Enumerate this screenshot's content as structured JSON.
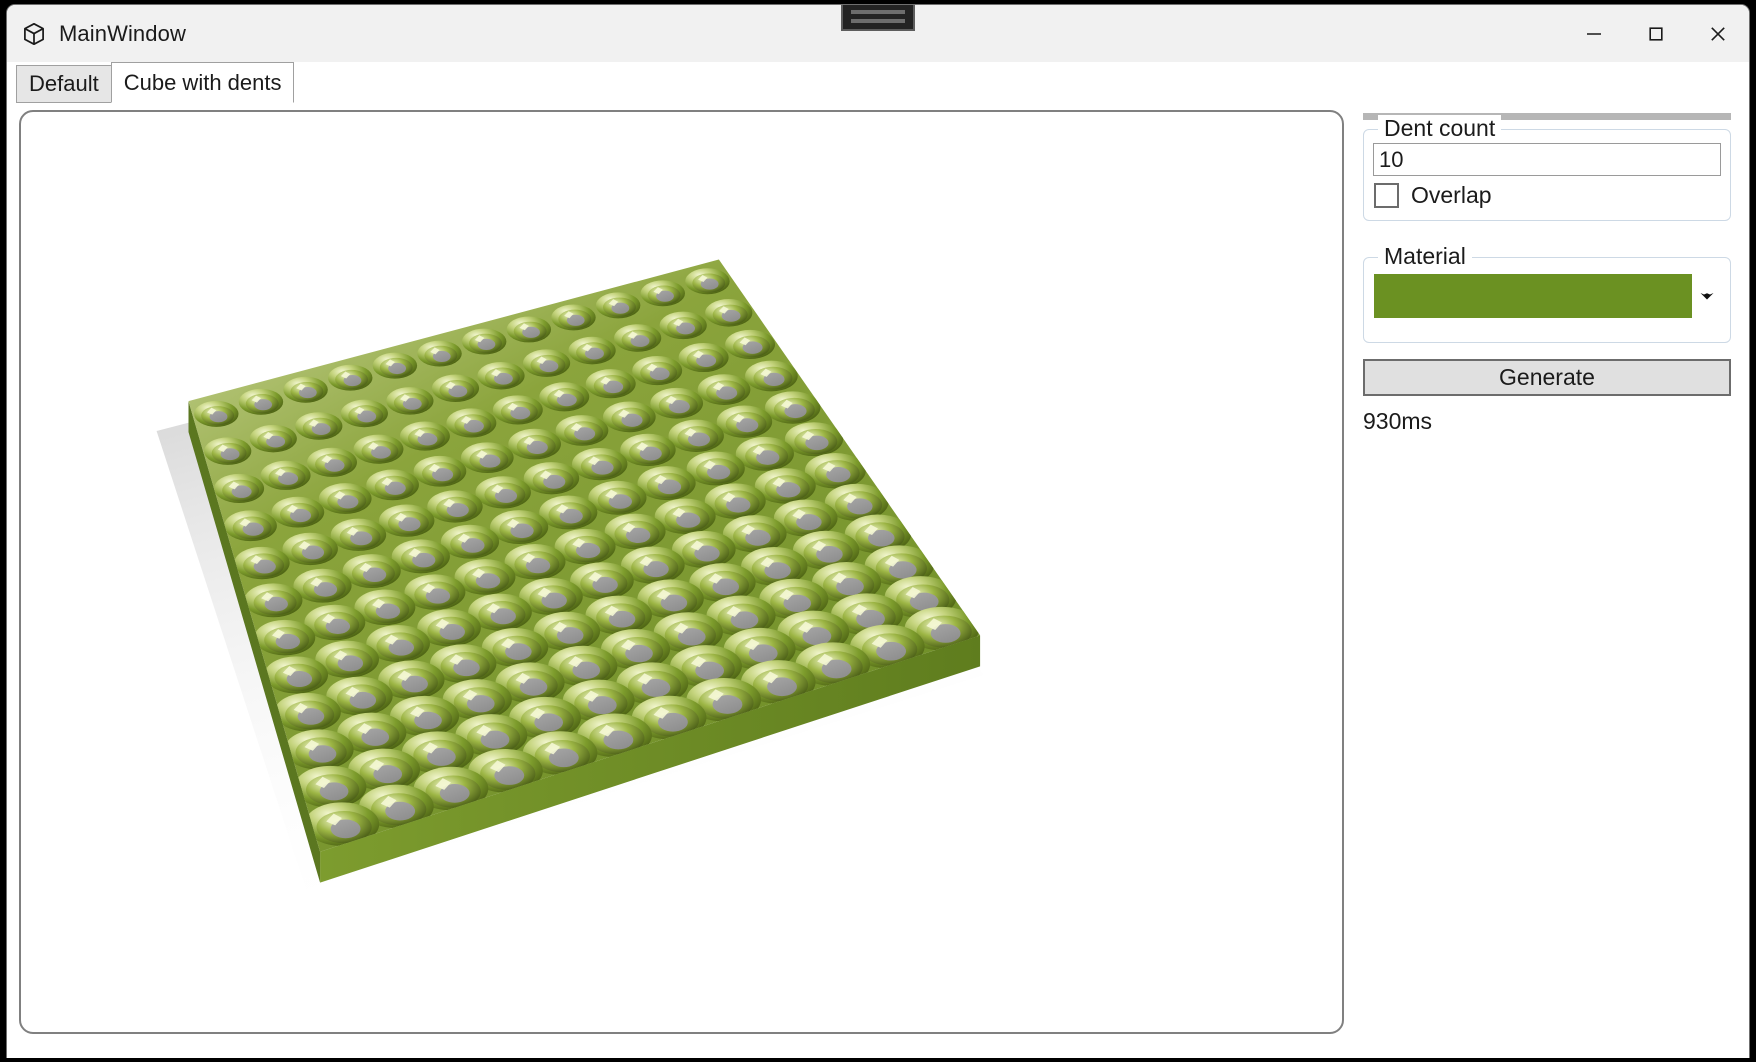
{
  "window": {
    "title": "MainWindow",
    "icon": "cube-icon",
    "caption_buttons": [
      {
        "name": "minimize",
        "glyph": "minimize-icon"
      },
      {
        "name": "maximize",
        "glyph": "maximize-icon"
      },
      {
        "name": "close",
        "glyph": "close-icon"
      }
    ],
    "snap_hint": "snap-layout-hint"
  },
  "tabs": [
    {
      "label": "Default",
      "active": false
    },
    {
      "label": "Cube with dents",
      "active": true
    }
  ],
  "panel": {
    "dent_group": {
      "label": "Dent count",
      "input_value": "10",
      "input_placeholder": "",
      "overlap_label": "Overlap",
      "overlap_checked": false
    },
    "material_group": {
      "label": "Material",
      "swatch_color": "#6b9122",
      "dropdown_icon": "chevron-down-icon"
    },
    "generate_label": "Generate",
    "timing_text": "930ms"
  },
  "viewport": {
    "name": "3d-viewport",
    "model": "dented-plate",
    "background": "#ffffff",
    "material_color": "#6b9122",
    "dent_interior_color": "#9b9b9b",
    "highlight_color": "#eef2c4",
    "shade_color": "#51691a",
    "top_face_color": "#c6d291",
    "side_face_color": "#6f8e28",
    "shadow_color": "#d8d8d8",
    "grid_rows": 12,
    "grid_cols": 12
  }
}
